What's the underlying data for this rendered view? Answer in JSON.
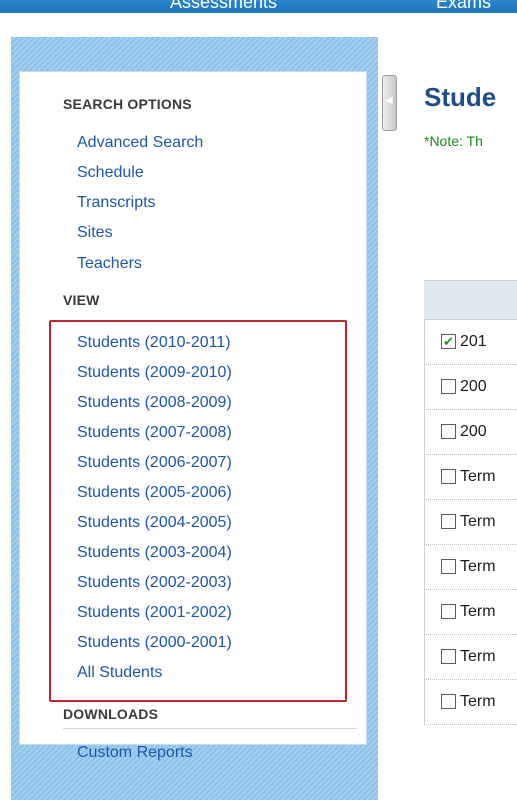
{
  "top_nav": {
    "items": [
      "Assessments",
      "Exams"
    ]
  },
  "sidebar": {
    "search_options": {
      "heading": "SEARCH OPTIONS",
      "items": [
        "Advanced Search",
        "Schedule",
        "Transcripts",
        "Sites",
        "Teachers"
      ]
    },
    "view": {
      "heading": "VIEW",
      "items": [
        "Students (2010-2011)",
        "Students (2009-2010)",
        "Students (2008-2009)",
        "Students (2007-2008)",
        "Students (2006-2007)",
        "Students (2005-2006)",
        "Students (2004-2005)",
        "Students (2003-2004)",
        "Students (2002-2003)",
        "Students (2001-2002)",
        "Students (2000-2001)",
        "All Students"
      ]
    },
    "downloads": {
      "heading": "DOWNLOADS",
      "items": [
        "Custom Reports"
      ]
    }
  },
  "collapse_icon": "chevron-left-icon",
  "main": {
    "title": "Stude",
    "note": "*Note: Th",
    "rows": [
      {
        "label": "201",
        "checked": true
      },
      {
        "label": "200",
        "checked": false
      },
      {
        "label": "200",
        "checked": false
      },
      {
        "label": "Term",
        "checked": false
      },
      {
        "label": "Term",
        "checked": false
      },
      {
        "label": "Term",
        "checked": false
      },
      {
        "label": "Term",
        "checked": false
      },
      {
        "label": "Term",
        "checked": false
      },
      {
        "label": "Term",
        "checked": false
      }
    ]
  },
  "colors": {
    "link": "#1d57a6",
    "highlight_border": "#c0272d",
    "note_green": "#1b8a1b",
    "title_blue": "#1d4f86",
    "sidebar_stripe": "#8ec1e9"
  }
}
